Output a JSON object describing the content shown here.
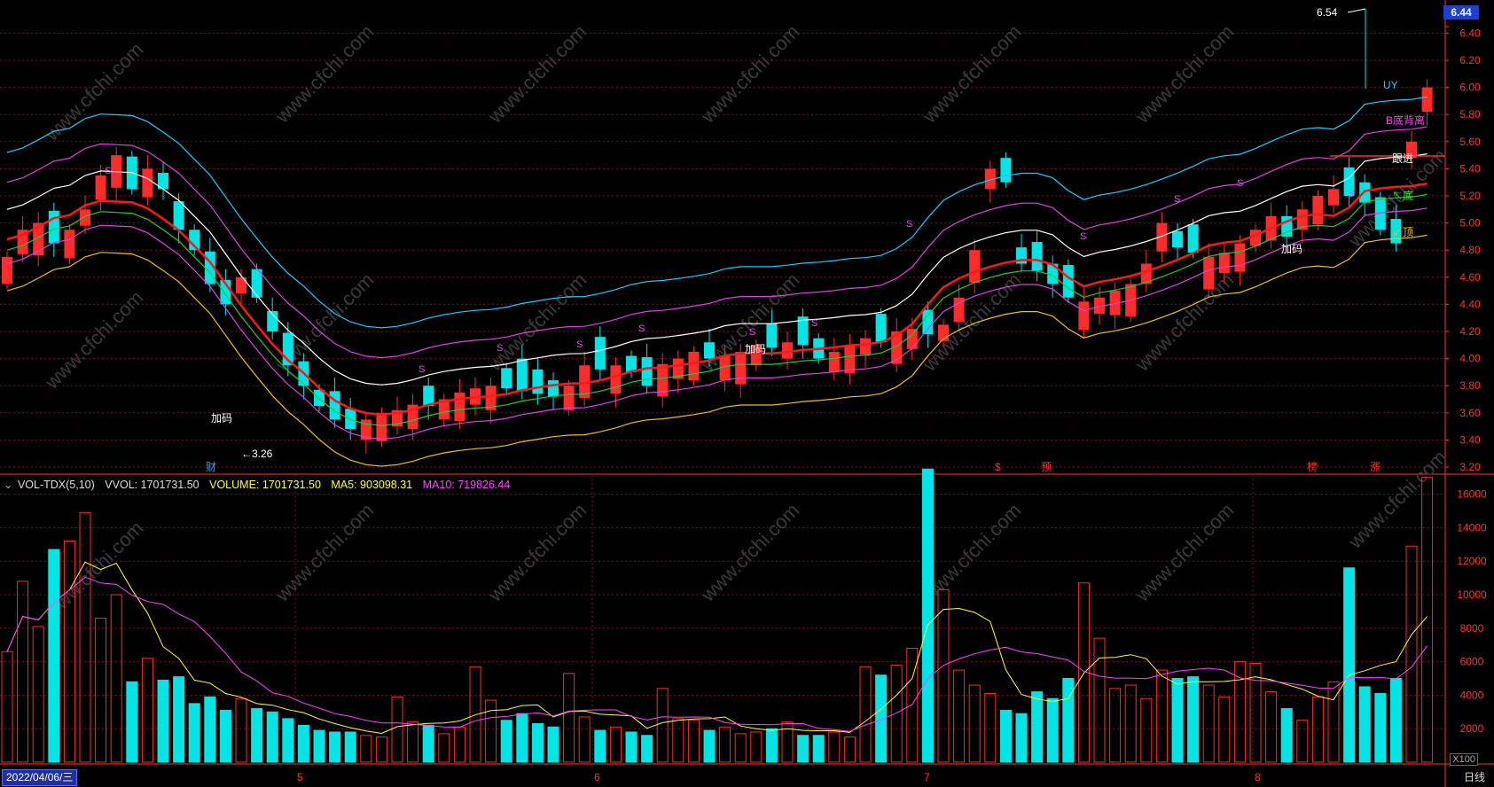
{
  "price_axis": {
    "ticks": [
      "6.44",
      "6.40",
      "6.20",
      "6.00",
      "5.80",
      "5.60",
      "5.40",
      "5.20",
      "5.00",
      "4.80",
      "4.60",
      "4.40",
      "4.20",
      "4.00",
      "3.80",
      "3.60",
      "3.40",
      "3.20"
    ]
  },
  "current_price": "6.44",
  "high_marker": "6.54",
  "low_marker": "←3.26",
  "volume_axis": {
    "ticks": [
      "16000",
      "14000",
      "12000",
      "10000",
      "8000",
      "6000",
      "4000",
      "2000"
    ],
    "unit": "X100"
  },
  "indicator": {
    "name": "VOL-TDX(5,10)",
    "vvol": "VVOL: 1701731.50",
    "volume": "VOLUME: 1701731.50",
    "ma5": "MA5: 903098.31",
    "ma10": "MA10: 719826.44"
  },
  "labels": {
    "uy": "UY",
    "bottom_divergence": "B底背离",
    "follow": "跟进",
    "bottom": "底",
    "top": "顶",
    "add1": "加码",
    "add2": "加码",
    "add3": "加码",
    "s": "S",
    "cai": "财",
    "yu": "预",
    "bang": "榜",
    "zhang": "涨",
    "dollar": "$"
  },
  "month_ticks": [
    "5",
    "6",
    "7",
    "8"
  ],
  "date": "2022/04/06/三",
  "period": "日线",
  "watermark": "www.cfchi.com",
  "colors": {
    "up": "#ff2a2a",
    "down": "#00e6e6",
    "grid": "#7a1010",
    "axis": "#ff3030",
    "ma_white": "#ffffff",
    "ma_magenta": "#e040e0",
    "ma_cyan": "#20c8ff",
    "ma_green": "#10d040",
    "ma_yellow": "#e8c020",
    "ma_red": "#ff1818"
  }
}
